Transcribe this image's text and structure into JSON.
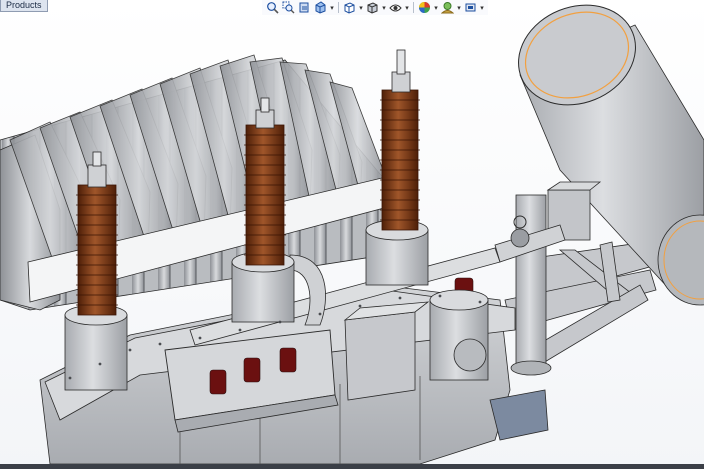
{
  "window": {
    "tab_label": "Products"
  },
  "view_toolbar": {
    "tools": [
      {
        "icon": "zoom-to-fit-icon"
      },
      {
        "icon": "zoom-to-area-icon"
      },
      {
        "icon": "previous-view-icon"
      },
      {
        "icon": "section-view-icon"
      },
      {
        "icon": "view-orientation-icon",
        "has_dropdown": true
      },
      {
        "icon": "display-style-icon",
        "has_dropdown": true
      },
      {
        "icon": "hide-show-items-icon",
        "has_dropdown": true
      },
      {
        "icon": "edit-appearance-icon",
        "has_dropdown": true
      },
      {
        "icon": "apply-scene-icon",
        "has_dropdown": true
      },
      {
        "icon": "view-settings-icon",
        "has_dropdown": true
      }
    ]
  },
  "model": {
    "name": "",
    "colors": {
      "body": "#c9cbcf",
      "body_shadow": "#9ea1a6",
      "edge": "#2b2b2b",
      "insulator": "#7a3a16",
      "insulator_dark": "#4a1d07",
      "small_insulator": "#6b1010",
      "pipe": "#d7d9dc",
      "selection_edge": "#f2a040"
    }
  }
}
